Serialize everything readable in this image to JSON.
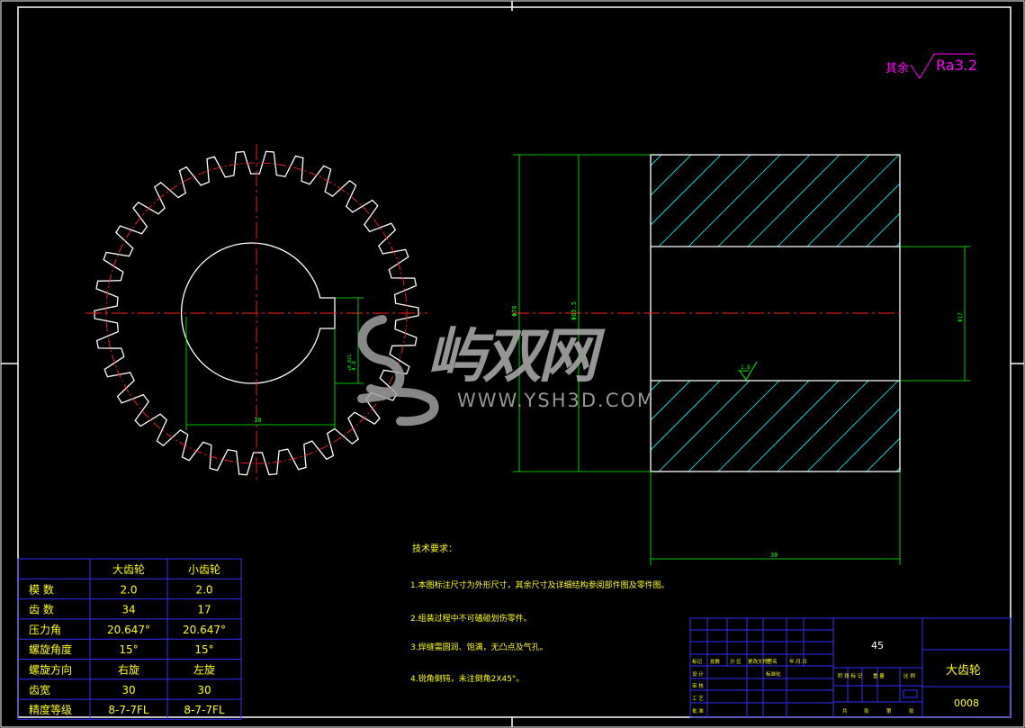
{
  "surface_roughness": {
    "prefix": "其余",
    "value": "Ra3.2"
  },
  "dimensions": {
    "left_width": "18",
    "left_height": "4.0",
    "left_height_tol": "+0.021",
    "d_outer": "Φ76",
    "d_pitch": "Φ65.5",
    "d_bore": "Φ17",
    "length": "30",
    "roughness_bore": "1.6"
  },
  "notes": {
    "title": "技术要求：",
    "items": [
      "1.本图标注尺寸为外形尺寸，其余尺寸及详细结构参阅部件图及零件图。",
      "2.组装过程中不可磕碰划伤零件。",
      "3.焊缝需圆润、饱满，无凸点及气孔。",
      "4.锐角倒钝，未注倒角2X45°。"
    ]
  },
  "param_table": {
    "headers": [
      "",
      "大齿轮",
      "小齿轮"
    ],
    "rows": [
      [
        "模   数",
        "2.0",
        "2.0"
      ],
      [
        "齿   数",
        "34",
        "17"
      ],
      [
        "压力角",
        "20.647°",
        "20.647°"
      ],
      [
        "螺旋角度",
        "15°",
        "15°"
      ],
      [
        "螺旋方向",
        "右旋",
        "左旋"
      ],
      [
        "齿宽",
        "30",
        "30"
      ],
      [
        "精度等级",
        "8-7-7FL",
        "8-7-7FL"
      ]
    ]
  },
  "title_block": {
    "material": "45",
    "part_name": "大齿轮",
    "drawing_no": "0008",
    "row_labels": [
      "标记",
      "处数",
      "分 区",
      "更改文件号",
      "签 名",
      "年.月.日"
    ],
    "sub_labels": [
      "设 计",
      "标准化"
    ],
    "stage_labels": [
      "阶 段 标 记",
      "重 量",
      "比 例"
    ],
    "bottom_labels": [
      "审 核",
      "工 艺",
      "批 准"
    ],
    "sheet_labels": [
      "共",
      "张",
      "第",
      "张"
    ]
  },
  "watermark": {
    "brand": "屿双网",
    "url": "WWW.YSH3D.COM"
  },
  "colors": {
    "bg": "#000000",
    "border": "#ffffff",
    "dim": "#00ff00",
    "center": "#ff2020",
    "hatch": "#00ffff",
    "table": "#3030ff",
    "magenta": "#ff00ff",
    "yellow": "#ffff00"
  }
}
